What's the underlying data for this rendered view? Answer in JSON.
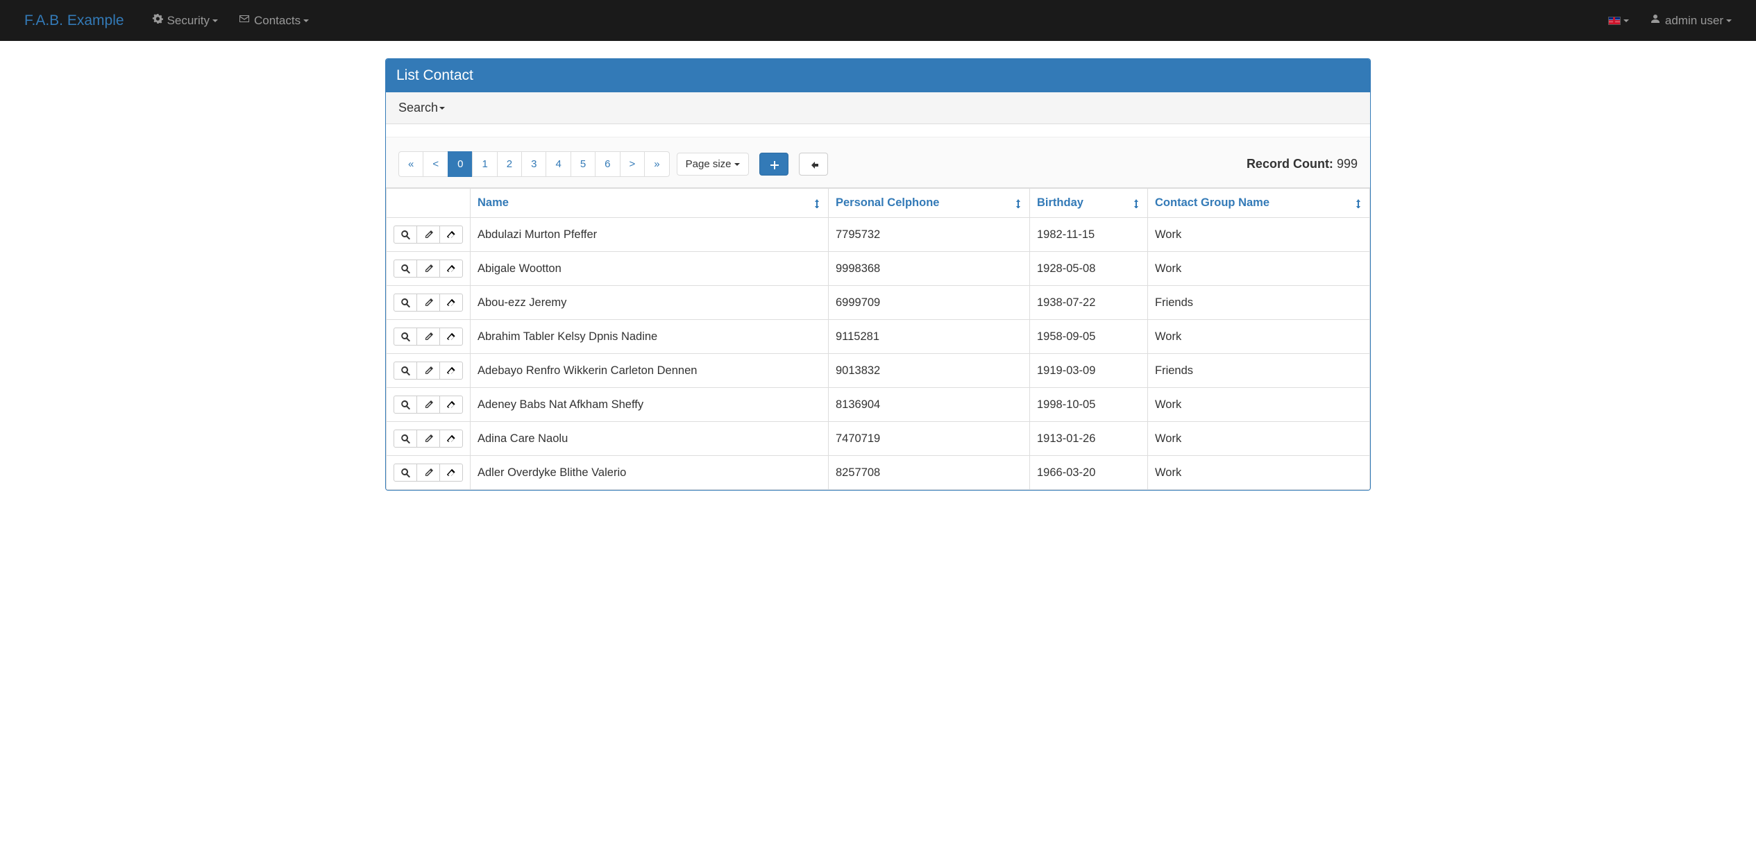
{
  "navbar": {
    "brand": "F.A.B. Example",
    "menus": [
      {
        "label": "Security",
        "icon": "gears"
      },
      {
        "label": "Contacts",
        "icon": "envelope"
      }
    ],
    "user_label": "admin user"
  },
  "panel": {
    "title": "List Contact",
    "search_label": "Search"
  },
  "pagination": {
    "pages": [
      "«",
      "<",
      "0",
      "1",
      "2",
      "3",
      "4",
      "5",
      "6",
      ">",
      "»"
    ],
    "active_index": 2,
    "page_size_label": "Page size"
  },
  "record_count": {
    "label": "Record Count:",
    "value": "999"
  },
  "columns": [
    {
      "label": "Name",
      "sortable": true
    },
    {
      "label": "Personal Celphone",
      "sortable": true
    },
    {
      "label": "Birthday",
      "sortable": true
    },
    {
      "label": "Contact Group Name",
      "sortable": true
    }
  ],
  "rows": [
    {
      "name": "Abdulazi Murton Pfeffer",
      "celphone": "7795732",
      "birthday": "1982-11-15",
      "group": "Work"
    },
    {
      "name": "Abigale Wootton",
      "celphone": "9998368",
      "birthday": "1928-05-08",
      "group": "Work"
    },
    {
      "name": "Abou-ezz Jeremy",
      "celphone": "6999709",
      "birthday": "1938-07-22",
      "group": "Friends"
    },
    {
      "name": "Abrahim Tabler Kelsy Dpnis Nadine",
      "celphone": "9115281",
      "birthday": "1958-09-05",
      "group": "Work"
    },
    {
      "name": "Adebayo Renfro Wikkerin Carleton Dennen",
      "celphone": "9013832",
      "birthday": "1919-03-09",
      "group": "Friends"
    },
    {
      "name": "Adeney Babs Nat Afkham Sheffy",
      "celphone": "8136904",
      "birthday": "1998-10-05",
      "group": "Work"
    },
    {
      "name": "Adina Care Naolu",
      "celphone": "7470719",
      "birthday": "1913-01-26",
      "group": "Work"
    },
    {
      "name": "Adler Overdyke Blithe Valerio",
      "celphone": "8257708",
      "birthday": "1966-03-20",
      "group": "Work"
    }
  ]
}
